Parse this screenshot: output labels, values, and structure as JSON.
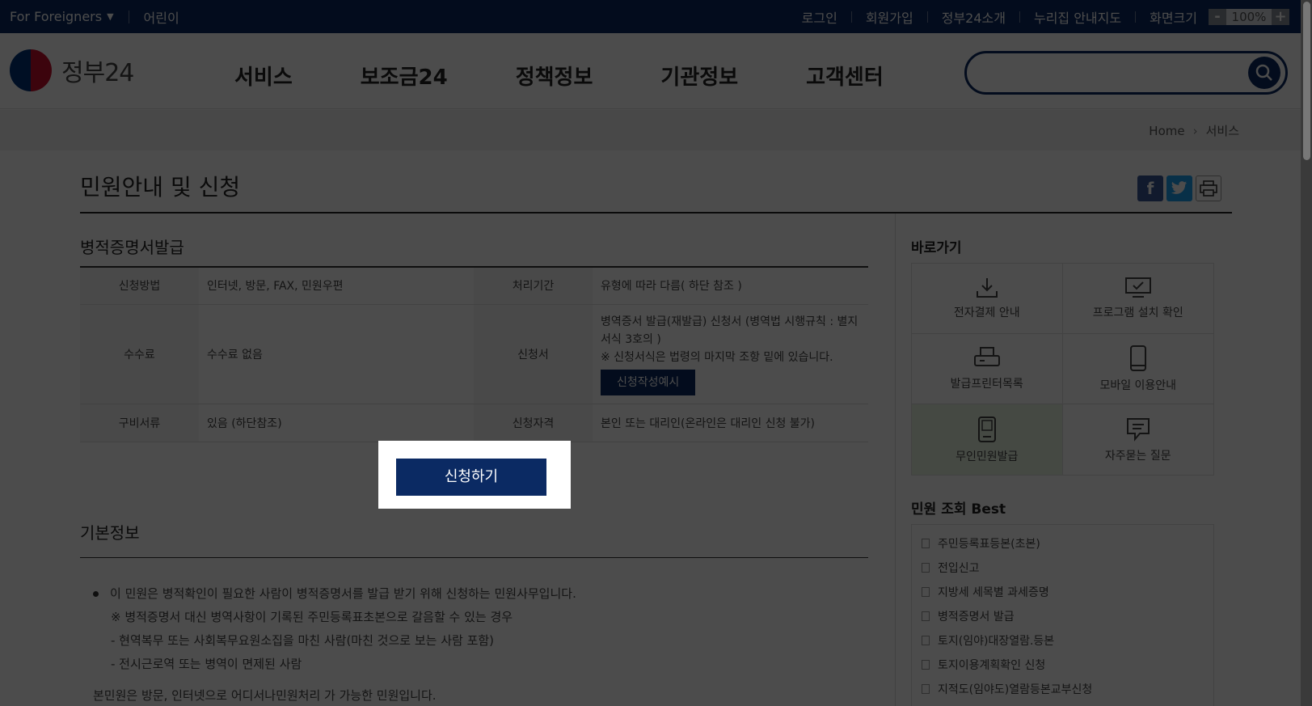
{
  "topbar": {
    "for_foreigners": "For Foreigners",
    "kids": "어린이",
    "login": "로그인",
    "signup": "회원가입",
    "about": "정부24소개",
    "sitemap": "누리집 안내지도",
    "screen_size": "화면크기",
    "zoom_minus": "-",
    "zoom_value": "100%",
    "zoom_plus": "+"
  },
  "header": {
    "logo_text": "정부24",
    "nav": [
      "서비스",
      "보조금24",
      "정책정보",
      "기관정보",
      "고객센터"
    ],
    "search_placeholder": ""
  },
  "breadcrumb": {
    "home": "Home",
    "current": "서비스"
  },
  "page": {
    "title": "민원안내 및 신청"
  },
  "section1": {
    "title": "병적증명서발급",
    "rows": [
      {
        "h1": "신청방법",
        "v1": "인터넷, 방문, FAX, 민원우편",
        "h2": "처리기간",
        "v2": "유형에 따라 다름( 하단 참조 )"
      },
      {
        "h1": "수수료",
        "v1": "수수료 없음",
        "h2": "신청서",
        "v2a": "병역증서 발급(재발급) 신청서 (병역법 시행규칙 : 별지서식 3호의 )",
        "v2b": "※ 신청서식은 법령의 마지막 조항 밑에 있습니다.",
        "form_btn": "신청작성예시"
      },
      {
        "h1": "구비서류",
        "v1": "있음 (하단참조)",
        "h2": "신청자격",
        "v2": "본인 또는 대리인(온라인은 대리인 신청 불가)"
      }
    ],
    "apply_button": "신청하기"
  },
  "section2": {
    "title": "기본정보",
    "line1": "이 민원은 병적확인이 필요한 사람이 병적증명서를 발급 받기 위해 신청하는 민원사무입니다.",
    "line2": "※ 병적증명서 대신 병역사항이 기록된 주민등록표초본으로 갈음할 수 있는 경우",
    "line3": "- 현역복무 또는 사회복무요원소집을 마친 사람(마친 것으로 보는 사람 포함)",
    "line4": "- 전시근로역 또는 병역이 면제된 사람",
    "line5": "본민원은 방문, 인터넷으로 어디서나민원처리 가 가능한 민원입니다."
  },
  "aside": {
    "shortcut_title": "바로가기",
    "shortcuts": [
      {
        "label": "전자결제 안내",
        "icon": "download-icon"
      },
      {
        "label": "프로그램 설치 확인",
        "icon": "monitor-check-icon"
      },
      {
        "label": "발급프린터목록",
        "icon": "printer-icon"
      },
      {
        "label": "모바일 이용안내",
        "icon": "mobile-icon"
      },
      {
        "label": "무인민원발급",
        "icon": "kiosk-icon"
      },
      {
        "label": "자주묻는 질문",
        "icon": "chat-icon"
      }
    ],
    "best_title": "민원 조회 Best",
    "best": [
      "주민등록표등본(초본)",
      "전입신고",
      "지방세 세목별 과세증명",
      "병적증명서 발급",
      "토지(임야)대장열람.등본",
      "토지이용계획확인 신청",
      "지적도(임야도)열람등본교부신청"
    ]
  }
}
